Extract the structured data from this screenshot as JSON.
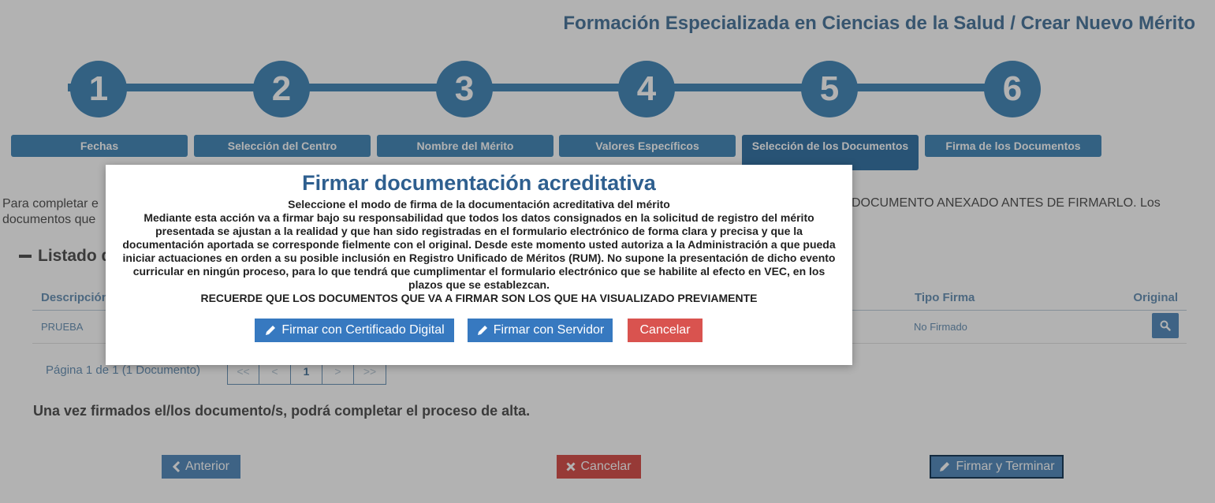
{
  "page": {
    "title": "Formación Especializada en Ciencias de la Salud / Crear Nuevo Mérito"
  },
  "stepper": {
    "steps": [
      {
        "number": "1",
        "label": "Fechas"
      },
      {
        "number": "2",
        "label": "Selección del Centro"
      },
      {
        "number": "3",
        "label": "Nombre del Mérito"
      },
      {
        "number": "4",
        "label": "Valores Específicos"
      },
      {
        "number": "5",
        "label": "Selección de los Documentos"
      },
      {
        "number": "6",
        "label": "Firma de los Documentos"
      }
    ]
  },
  "intro": {
    "left_fragment": "Para completar e",
    "left_fragment_2": "documentos que",
    "right_fragment": "DOCUMENTO ANEXADO ANTES DE FIRMARLO. Los"
  },
  "section": {
    "title_fragment": "Listado d"
  },
  "table": {
    "headers": {
      "description": "Descripción",
      "signature_type": "Tipo Firma",
      "original": "Original"
    },
    "rows": [
      {
        "description": "PRUEBA",
        "signature_type": "No Firmado"
      }
    ]
  },
  "pagination": {
    "info": "Página 1 de 1 (1 Documento)",
    "first": "<<",
    "prev": "<",
    "current": "1",
    "next": ">",
    "last": ">>"
  },
  "final_note": "Una vez firmados el/los documento/s, podrá completar el proceso de alta.",
  "footer_buttons": {
    "previous": "Anterior",
    "cancel": "Cancelar",
    "sign_finish": "Firmar y Terminar"
  },
  "modal": {
    "title": "Firmar documentación acreditativa",
    "subtitle": "Seleccione el modo de firma de la documentación acreditativa del mérito",
    "body": "Mediante esta acción va a firmar bajo su responsabilidad que todos los datos consignados en la solicitud de registro del mérito presentada se ajustan a la realidad y que han sido registradas en el formulario electrónico de forma clara y precisa y que la documentación aportada se corresponde fielmente con el original. Desde este momento usted autoriza a la Administración a que pueda iniciar actuaciones en orden a su posible inclusión en Registro Unificado de Méritos (RUM). No supone la presentación de dicho evento curricular en ningún proceso, para lo que tendrá que cumplimentar el formulario electrónico que se habilite al efecto en VEC, en los plazos que se establezcan.",
    "warning": "RECUERDE QUE LOS DOCUMENTOS QUE VA A FIRMAR SON LOS QUE HA VISUALIZADO PREVIAMENTE",
    "buttons": {
      "sign_certificate": "Firmar con Certificado Digital",
      "sign_server": "Firmar con Servidor",
      "cancel": "Cancelar"
    }
  },
  "colors": {
    "accent": "#4a8cbb",
    "title": "#4f7aa0",
    "modal_title": "#2e5f8f",
    "danger": "#d9534f",
    "primary_button": "#3779c0"
  }
}
